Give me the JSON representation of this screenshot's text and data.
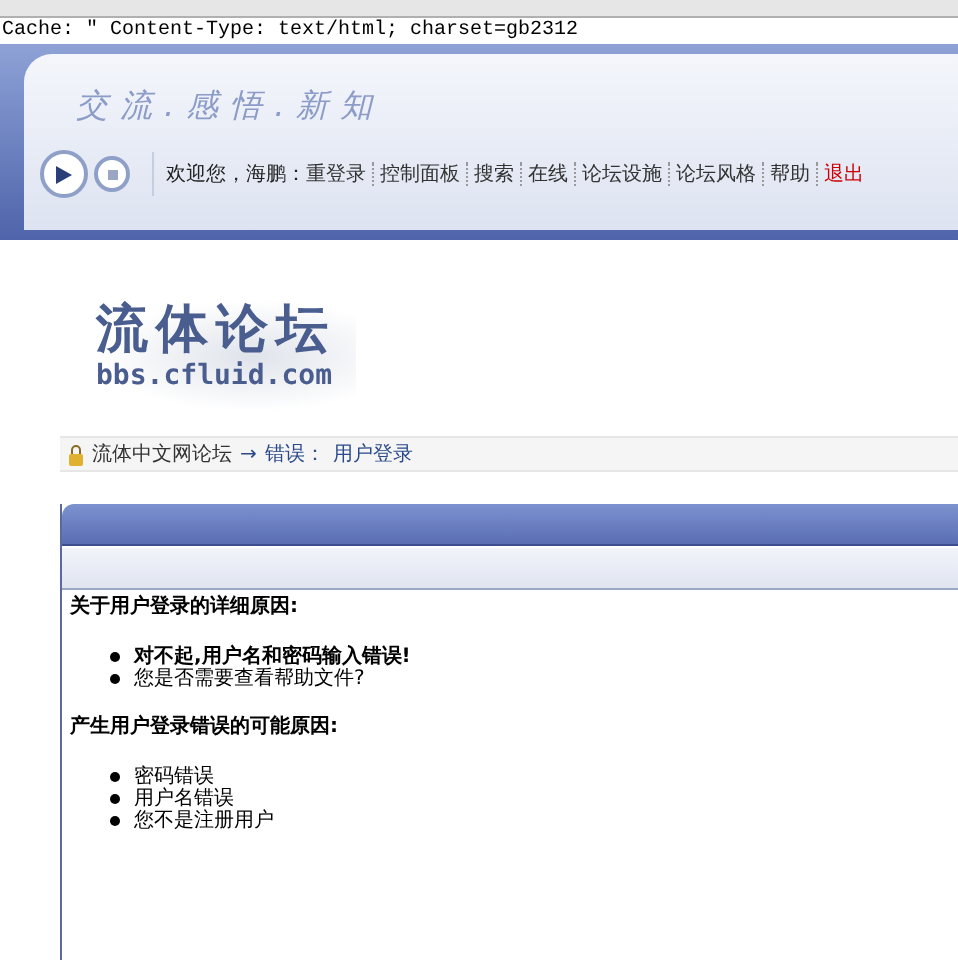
{
  "meta_line": "Cache: \" Content-Type: text/html; charset=gb2312",
  "header": {
    "slogan": "交流.感悟.新知",
    "welcome": "欢迎您，海鹏：",
    "nav": [
      {
        "label": "重登录",
        "color": "#333333"
      },
      {
        "label": "控制面板",
        "color": "#333333"
      },
      {
        "label": "搜索",
        "color": "#333333"
      },
      {
        "label": "在线",
        "color": "#333333"
      },
      {
        "label": "论坛设施",
        "color": "#333333"
      },
      {
        "label": "论坛风格",
        "color": "#333333"
      },
      {
        "label": "帮助",
        "color": "#333333"
      },
      {
        "label": "退出",
        "color": "#cc0000"
      }
    ]
  },
  "logo": {
    "title": "流体论坛",
    "url": "bbs.cfluid.com"
  },
  "breadcrumb": [
    "流体中文网论坛",
    "→",
    "错误：",
    "用户登录"
  ],
  "error_panel": {
    "sections": [
      {
        "heading": "关于用户登录的详细原因:",
        "items": [
          {
            "text": "对不起,用户名和密码输入错误!",
            "bold": true
          },
          {
            "text": "您是否需要查看帮助文件?",
            "bold": false
          }
        ]
      },
      {
        "heading": "产生用户登录错误的可能原因:",
        "items": [
          {
            "text": "密码错误",
            "bold": false
          },
          {
            "text": "用户名错误",
            "bold": false
          },
          {
            "text": "您不是注册用户",
            "bold": false
          }
        ]
      }
    ]
  }
}
